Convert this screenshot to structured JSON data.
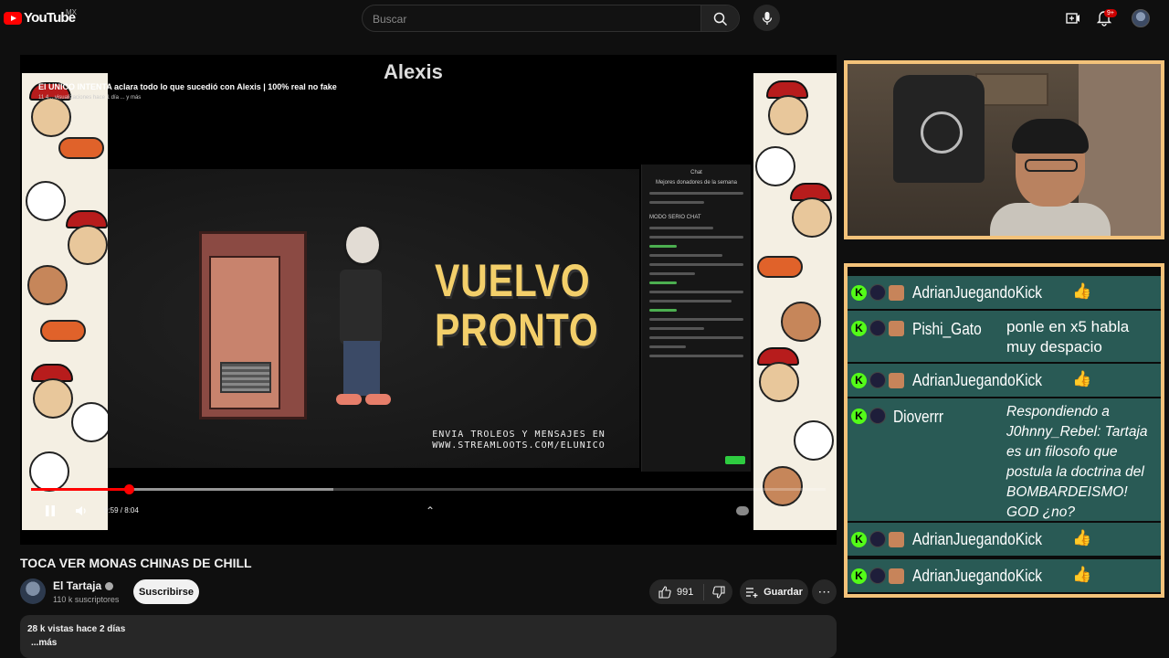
{
  "header": {
    "logo_text": "YouTube",
    "country_code": "MX",
    "search_placeholder": "Buscar",
    "notifications_badge": "9+"
  },
  "player": {
    "overlay_title": "El UNICO INTENTA aclara todo lo que sucedió con Alexis | 100% real no fake",
    "overlay_meta": "11 4... visualizaciones   hace 1 día   ... y más",
    "overlay_top_text": "Alexis",
    "stream_text": "VUELVO PRONTO",
    "stream_banner": "ENVIA TROLEOS Y MENSAJES EN WWW.STREAMLOOTS.COM/ELUNICO",
    "stream_chat_title": "Chat",
    "stream_chat_subtitle": "Mejores donadores de la semana",
    "stream_chat_mode": "MODO SERIO CHAT",
    "time_display": "0:59 / 8:04",
    "progress": 0.123,
    "buffered": 0.38
  },
  "kick_chat": {
    "accent_color": "#53fc18",
    "rows": [
      {
        "user": "AdrianJuegandoKick",
        "emoji": "👍",
        "message": ""
      },
      {
        "user": "Pishi_Gato",
        "emoji": "",
        "message": "ponle en x5 habla muy despacio"
      },
      {
        "user": "AdrianJuegandoKick",
        "emoji": "👍",
        "message": ""
      },
      {
        "user": "Dioverrr",
        "emoji": "",
        "message": "Respondiendo a J0hnny_Rebel: Tartaja es un filosofo que postula la doctrina del BOMBARDEISMO! GOD ¿no?"
      },
      {
        "user": "AdrianJuegandoKick",
        "emoji": "👍",
        "message": ""
      },
      {
        "user": "AdrianJuegandoKick",
        "emoji": "👍",
        "message": ""
      }
    ]
  },
  "video": {
    "title": "TOCA VER MONAS CHINAS DE CHILL",
    "channel": "El Tartaja",
    "subscribers": "110 k suscriptores",
    "subscribe_label": "Suscribirse",
    "likes": "991",
    "save_label": "Guardar",
    "views_date": "28 k vistas  hace 2 días",
    "more_label": "...más"
  }
}
